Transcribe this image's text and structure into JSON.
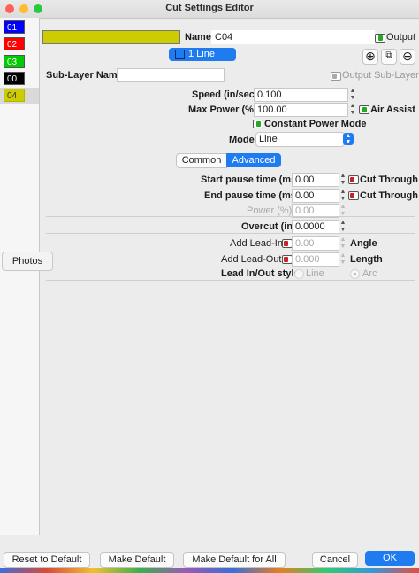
{
  "window": {
    "title": "Cut Settings Editor"
  },
  "layers": [
    {
      "label": "01",
      "color": "#0000ff",
      "text_color": "#ffffff"
    },
    {
      "label": "02",
      "color": "#ff0000",
      "text_color": "#ffffff"
    },
    {
      "label": "03",
      "color": "#00cc00",
      "text_color": "#ffffff"
    },
    {
      "label": "00",
      "color": "#000000",
      "text_color": "#ffffff"
    },
    {
      "label": "04",
      "color": "#cccc00",
      "text_color": "#333333"
    }
  ],
  "photos_label": "Photos",
  "layer_color": "#cccc00",
  "name": {
    "label": "Name",
    "value": "C04"
  },
  "output_label": "Output",
  "sub_layer_tab": "1 Line",
  "sub_layer_name_label": "Sub-Layer Name",
  "sub_layer_name_value": "",
  "output_sub_layer_label": "Output Sub-Layer",
  "speed": {
    "label": "Speed (in/sec)",
    "value": "0.100"
  },
  "max_power": {
    "label": "Max Power (%)",
    "value": "100.00"
  },
  "air_assist_label": "Air Assist",
  "constant_power_label": "Constant Power Mode",
  "mode": {
    "label": "Mode",
    "value": "Line"
  },
  "tabs": {
    "common": "Common",
    "advanced": "Advanced"
  },
  "start_pause": {
    "label": "Start pause time (ms)",
    "value": "0.00",
    "option": "Cut Through"
  },
  "end_pause": {
    "label": "End pause time (ms)",
    "value": "0.00",
    "option": "Cut Through"
  },
  "power": {
    "label": "Power (%)",
    "value": "0.00"
  },
  "overcut": {
    "label": "Overcut (in)",
    "value": "0.0000"
  },
  "lead_in": {
    "label": "Add Lead-In",
    "value": "0.00",
    "suffix": "Angle"
  },
  "lead_out": {
    "label": "Add Lead-Out",
    "value": "0.000",
    "suffix": "Length"
  },
  "lead_style": {
    "label": "Lead In/Out style",
    "options": [
      "Line",
      "Arc"
    ],
    "selected": "Arc"
  },
  "footer": {
    "reset": "Reset to Default",
    "make_default": "Make Default",
    "make_default_all": "Make Default for All",
    "cancel": "Cancel",
    "ok": "OK"
  },
  "colors": {
    "accent": "#1f7cf0",
    "toggle_on": "#22aa22",
    "toggle_off": "#cc2222"
  }
}
